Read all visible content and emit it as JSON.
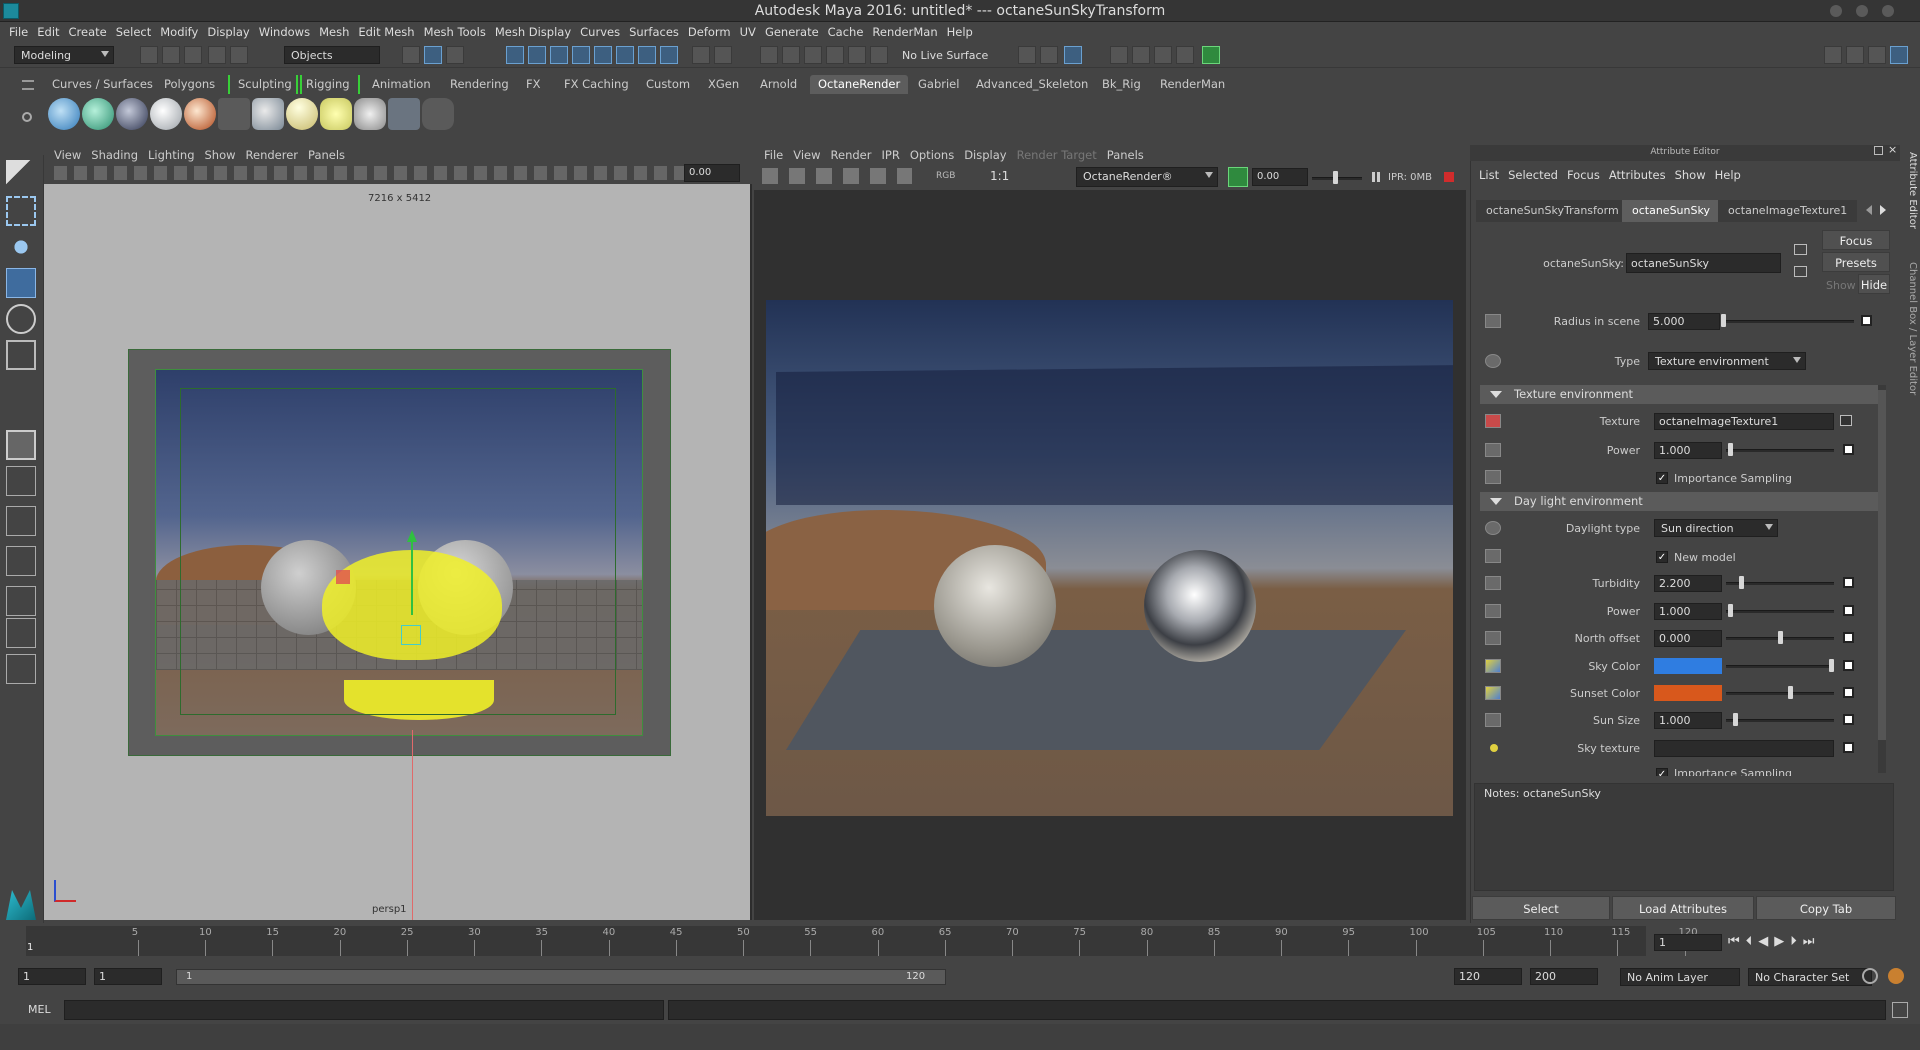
{
  "window": {
    "title": "Autodesk Maya 2016: untitled*   ---   octaneSunSkyTransform"
  },
  "menu": [
    "File",
    "Edit",
    "Create",
    "Select",
    "Modify",
    "Display",
    "Windows",
    "Mesh",
    "Edit Mesh",
    "Mesh Tools",
    "Mesh Display",
    "Curves",
    "Surfaces",
    "Deform",
    "UV",
    "Generate",
    "Cache",
    "RenderMan",
    "Help"
  ],
  "status": {
    "mode": "Modeling",
    "objects": "Objects",
    "live_surface": "No Live Surface"
  },
  "shelf_tabs": [
    "Curves / Surfaces",
    "Polygons",
    "Sculpting",
    "Rigging",
    "Animation",
    "Rendering",
    "FX",
    "FX Caching",
    "Custom",
    "XGen",
    "Arnold",
    "OctaneRender",
    "Gabriel",
    "Advanced_Skeleton",
    "Bk_Rig",
    "RenderMan"
  ],
  "shelf_active": "OctaneRender",
  "viewport": {
    "menu": [
      "View",
      "Shading",
      "Lighting",
      "Show",
      "Renderer",
      "Panels"
    ],
    "resolution": "7216 x 5412",
    "camera": "persp1",
    "exposure": "0.00"
  },
  "render_view": {
    "menu": [
      "File",
      "View",
      "Render",
      "IPR",
      "Options",
      "Display",
      "Render Target",
      "Panels"
    ],
    "ratio": "1:1",
    "rgb": "RGB",
    "renderer": "OctaneRender®",
    "exposure": "0.00",
    "ipr": "IPR: 0MB"
  },
  "attribute_editor": {
    "header": "Attribute Editor",
    "menu": [
      "List",
      "Selected",
      "Focus",
      "Attributes",
      "Show",
      "Help"
    ],
    "tabs": [
      "octaneSunSkyTransform",
      "octaneSunSky",
      "octaneImageTexture1"
    ],
    "active_tab": "octaneSunSky",
    "node_label": "octaneSunSky:",
    "node_name": "octaneSunSky",
    "focus": "Focus",
    "presets": "Presets",
    "show": "Show",
    "hide": "Hide",
    "radius_label": "Radius in scene",
    "radius": "5.000",
    "type_label": "Type",
    "type": "Texture environment",
    "section_texture": "Texture environment",
    "texture_label": "Texture",
    "texture": "octaneImageTexture1",
    "power_label": "Power",
    "power": "1.000",
    "importance_sampling": "Importance Sampling",
    "section_daylight": "Day light environment",
    "daylight_type_label": "Daylight type",
    "daylight_type": "Sun direction",
    "new_model": "New model",
    "turbidity_label": "Turbidity",
    "turbidity": "2.200",
    "power2_label": "Power",
    "power2": "1.000",
    "north_offset_label": "North offset",
    "north_offset": "0.000",
    "sky_color_label": "Sky Color",
    "sky_color": "#2f7de1",
    "sunset_color_label": "Sunset Color",
    "sunset_color": "#d8581c",
    "sun_size_label": "Sun Size",
    "sun_size": "1.000",
    "sky_texture_label": "Sky texture",
    "importance_sampling2": "Importance Sampling",
    "notes": "Notes:  octaneSunSky",
    "buttons": [
      "Select",
      "Load Attributes",
      "Copy Tab"
    ]
  },
  "side_tabs": [
    "Attribute Editor",
    "Channel Box / Layer Editor"
  ],
  "timeline": {
    "ticks": [
      "5",
      "10",
      "15",
      "20",
      "25",
      "30",
      "35",
      "40",
      "45",
      "50",
      "55",
      "60",
      "65",
      "70",
      "75",
      "80",
      "85",
      "90",
      "95",
      "100",
      "105",
      "110",
      "115",
      "120"
    ],
    "current": "1",
    "frame_field": "1"
  },
  "range": {
    "start": "1",
    "anim_start": "1",
    "range_start": "1",
    "range_end": "120",
    "end": "120",
    "anim_end": "200",
    "anim_layer": "No Anim Layer",
    "char_set": "No Character Set"
  },
  "cmd": {
    "lang": "MEL"
  }
}
